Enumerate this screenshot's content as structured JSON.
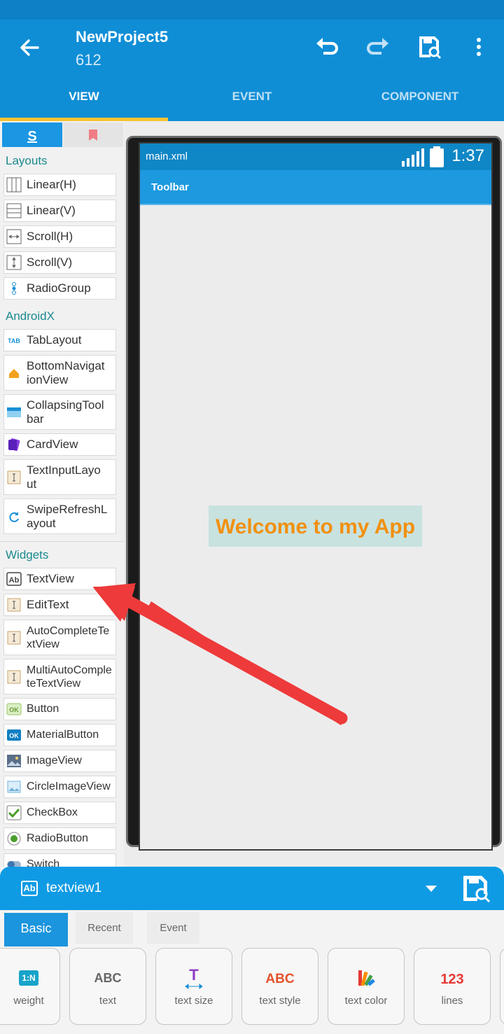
{
  "header": {
    "title": "NewProject5",
    "subtitle": "612"
  },
  "tabs": [
    {
      "label": "VIEW"
    },
    {
      "label": "EVENT"
    },
    {
      "label": "COMPONENT"
    }
  ],
  "palette": {
    "sections": [
      {
        "title": "Layouts",
        "items": [
          "Linear(H)",
          "Linear(V)",
          "Scroll(H)",
          "Scroll(V)",
          "RadioGroup"
        ]
      },
      {
        "title": "AndroidX",
        "items": [
          "TabLayout",
          "BottomNavigat\nionView",
          "CollapsingTool\nbar",
          "CardView",
          "TextInputLayo\nut",
          "SwipeRefreshL\nayout"
        ]
      },
      {
        "title": "Widgets",
        "items": [
          "TextView",
          "EditText",
          "AutoCompleteTe\nxtView",
          "MultiAutoComple\nteTextView",
          "Button",
          "MaterialButton",
          "ImageView",
          "CircleImageView",
          "CheckBox",
          "RadioButton",
          "Switch"
        ]
      }
    ]
  },
  "preview": {
    "file": "main.xml",
    "time": "1:37",
    "toolbar": "Toolbar",
    "welcome": "Welcome to my App"
  },
  "selection": {
    "name": "textview1",
    "icon_text": "Ab"
  },
  "prop_tabs": [
    "Basic",
    "Recent",
    "Event"
  ],
  "props": [
    {
      "label": "weight",
      "icon_text": "1:N"
    },
    {
      "label": "text",
      "icon_text": "ABC"
    },
    {
      "label": "text size",
      "icon_text": "T"
    },
    {
      "label": "text style",
      "icon_text": "ABC"
    },
    {
      "label": "text color",
      "icon_text": ""
    },
    {
      "label": "lines",
      "icon_text": "123"
    }
  ],
  "colors": {
    "primary": "#0f8ed6",
    "accent": "#f7c232",
    "welcome_text": "#f1900f",
    "arrow": "#ee3a3a"
  }
}
